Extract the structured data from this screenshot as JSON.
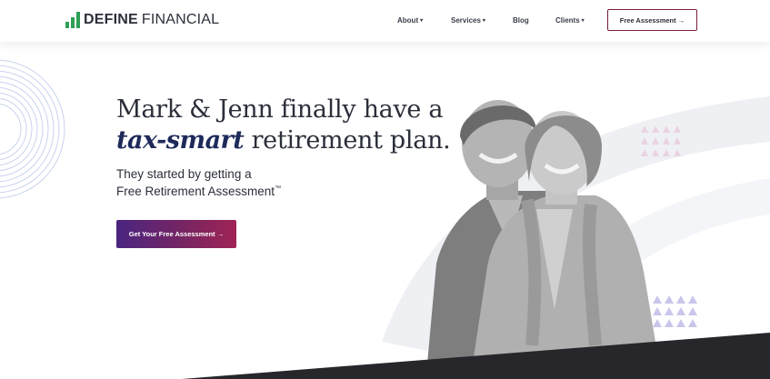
{
  "brand": {
    "name_bold": "DEFINE",
    "name_light": "FINANCIAL",
    "accent": "#7a2035",
    "logo_green": "#2e9e55"
  },
  "nav": {
    "items": [
      {
        "label": "About",
        "dropdown": true
      },
      {
        "label": "Services",
        "dropdown": true
      },
      {
        "label": "Blog",
        "dropdown": false
      },
      {
        "label": "Clients",
        "dropdown": true
      }
    ],
    "cta_label": "Free Assessment →"
  },
  "hero": {
    "headline_line1": "Mark & Jenn finally have a",
    "headline_emphasis": "tax-smart",
    "headline_line2_rest": "retirement plan.",
    "subhead_line1": "They started by getting a",
    "subhead_line2": "Free Retirement Assessment",
    "trademark": "™",
    "cta_label": "Get Your Free Assessment →"
  },
  "icons": {
    "caret": "▾",
    "logo": "bar-chart-logo-icon"
  },
  "colors": {
    "text": "#2b2f3a",
    "emphasis": "#1e2a5a",
    "cta_gradient_start": "#4a2580",
    "cta_gradient_end": "#a02355",
    "dark_band": "#26262b",
    "triangle_pink": "#ead3e0",
    "triangle_lavender": "#c9c6ec"
  }
}
